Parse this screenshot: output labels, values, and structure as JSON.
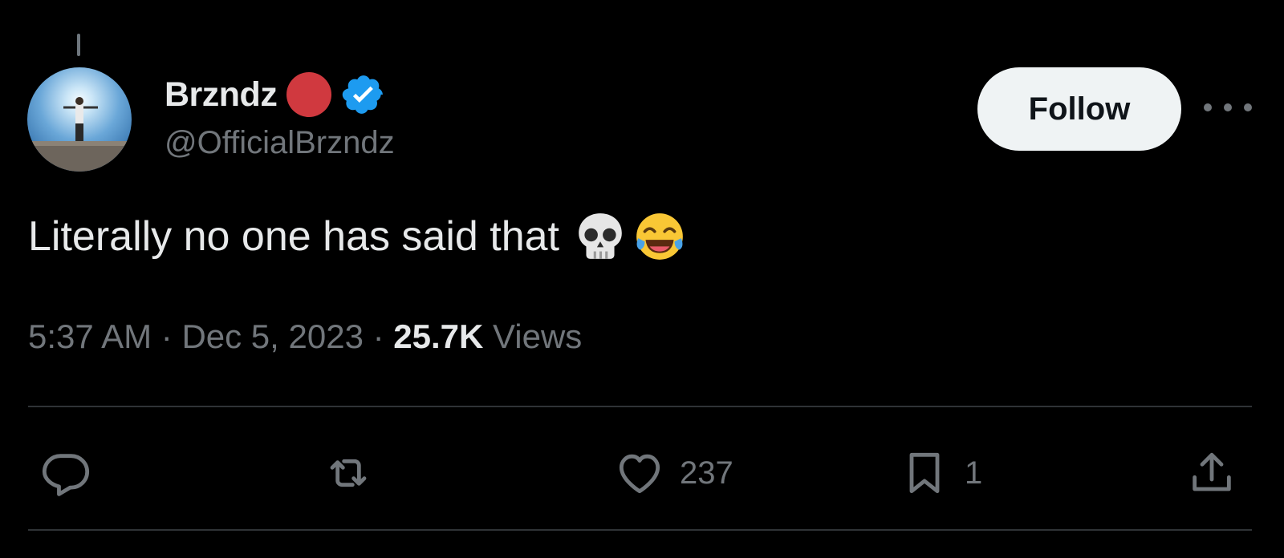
{
  "tweet": {
    "author": {
      "display_name": "Brzndz",
      "handle": "@OfficialBrzndz",
      "name_dot_color": "#d0393f",
      "verified_color": "#1d9bf0",
      "avatar_icon": "avatar-photo-icon"
    },
    "follow_label": "Follow",
    "text": "Literally no one has said that",
    "emojis": [
      "skull-emoji-icon",
      "tears-of-joy-emoji-icon"
    ],
    "time": "5:37 AM",
    "separator": " · ",
    "date": "Dec 5, 2023",
    "views_count": "25.7K",
    "views_label": "Views"
  },
  "actions": {
    "reply_icon": "reply-icon",
    "retweet_icon": "retweet-icon",
    "like_icon": "heart-icon",
    "like_count": "237",
    "bookmark_icon": "bookmark-icon",
    "bookmark_count": "1",
    "share_icon": "share-icon"
  },
  "colors": {
    "background": "#000000",
    "primary_text": "#e7e9ea",
    "secondary_text": "#71767b",
    "divider": "#2f3336",
    "follow_bg": "#eff3f4"
  }
}
